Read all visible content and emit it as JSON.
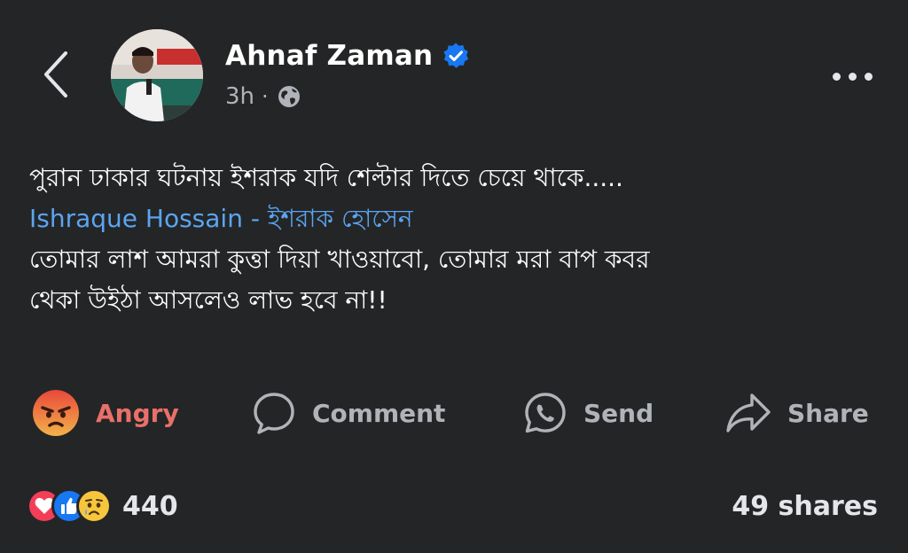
{
  "header": {
    "author_name": "Ahnaf Zaman",
    "timestamp": "3h",
    "separator": "·",
    "icons": {
      "back": "chevron-left-icon",
      "verified": "verified-badge-icon",
      "privacy": "globe-icon",
      "more": "more-horizontal-icon"
    }
  },
  "post": {
    "line1": "পুরান ঢাকার ঘটনায় ইশরাক যদি শেল্টার দিতে চেয়ে থাকে.....",
    "mention": "Ishraque Hossain - ইশরাক হোসেন",
    "line3": "তোমার লাশ আমরা কুত্তা দিয়া খাওয়াবো, তোমার মরা বাপ কবর",
    "line4": "থেকা উইঠা আসলেও লাভ হবে না!!"
  },
  "actions": {
    "react_label": "Angry",
    "comment_label": "Comment",
    "send_label": "Send",
    "share_label": "Share"
  },
  "footer": {
    "reaction_count": "440",
    "shares": "49 shares",
    "reaction_icons": [
      "love-reaction-icon",
      "like-reaction-icon",
      "sad-reaction-icon"
    ]
  },
  "colors": {
    "background": "#242526",
    "mention": "#5aa5f2",
    "angry": "#e9706a",
    "muted": "#b0b3b8",
    "verified": "#1877f2"
  }
}
